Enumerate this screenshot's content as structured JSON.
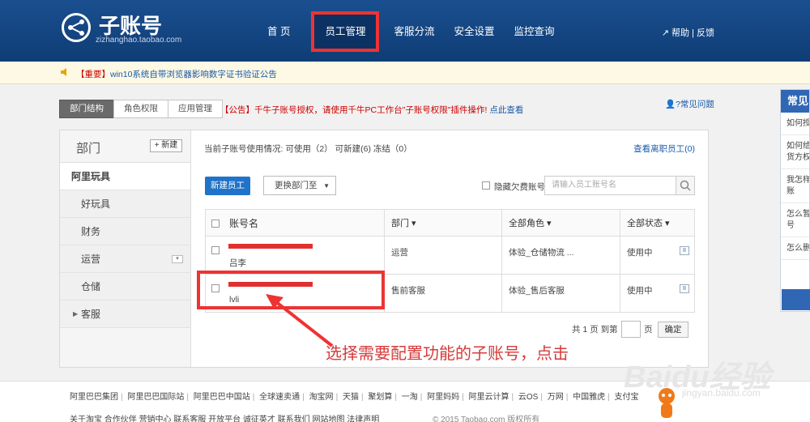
{
  "header": {
    "logo_title": "子账号",
    "logo_subtitle": "zizhanghao.taobao.com",
    "nav": [
      "首 页",
      "员工管理",
      "客服分流",
      "安全设置",
      "监控查询"
    ],
    "links": "帮助 | 反馈"
  },
  "notice": {
    "tag": "【重要】",
    "text": "win10系统自带浏览器影响数字证书验证公告"
  },
  "tabs": [
    "部门结构",
    "角色权限",
    "应用管理"
  ],
  "announce": {
    "text": "【公告】千牛子账号授权，请使用千牛PC工作台\"子账号权限\"插件操作! ",
    "link": "点此查看"
  },
  "faq_link": "常见问题",
  "sidebar": {
    "title": "部门",
    "new_label": "+ 新建",
    "root": "阿里玩具",
    "items": [
      "好玩具",
      "财务",
      "运营",
      "仓储",
      "客服"
    ]
  },
  "content": {
    "usage_label": "当前子账号使用情况:",
    "usage_available": "可使用（2）",
    "usage_new": "可新建(6)",
    "usage_frozen": "冻结（0）",
    "resigned_link": "查看离职员工(0)",
    "btn_new": "新建员工",
    "btn_move": "更换部门至",
    "hide_label": "隐藏欠费账号",
    "search_placeholder": "请输入员工账号名"
  },
  "table": {
    "headers": [
      "账号名",
      "部门 ▾",
      "全部角色 ▾",
      "全部状态 ▾"
    ],
    "rows": [
      {
        "account_sub": "吕李",
        "dept": "运营",
        "role": "体验_仓储物流 ...",
        "status": "使用中"
      },
      {
        "account_sub": "lvli",
        "dept": "售前客服",
        "role": "体验_售后客服",
        "status": "使用中"
      }
    ]
  },
  "pager": {
    "text": "共 1 页 到第",
    "page": "页",
    "ok": "确定"
  },
  "callout": "选择需要配置功能的子账号，点击",
  "faq_panel": {
    "title": "常见",
    "questions": [
      "如何授号?",
      "如何给如发货方权限",
      "我怎样的子账",
      "怎么暂子账号",
      "怎么删"
    ]
  },
  "footer": {
    "links1": [
      "阿里巴巴集团",
      "阿里巴巴国际站",
      "阿里巴巴中国站",
      "全球速卖通",
      "淘宝网",
      "天猫",
      "聚划算",
      "一淘",
      "阿里妈妈",
      "阿里云计算",
      "云OS",
      "万网",
      "中国雅虎",
      "支付宝"
    ],
    "links2": [
      "关于淘宝",
      "合作伙伴",
      "营销中心",
      "联系客服",
      "开放平台",
      "诚征英才",
      "联系我们",
      "网站地图",
      "法律声明"
    ],
    "copyright": "© 2015 Taobao.com 版权所有"
  },
  "watermark": {
    "text": "Baidu经验",
    "sub": "jingyan.baidu.com"
  },
  "colors": {
    "header": "#0f3d75",
    "accent": "#1f73c9",
    "highlight": "#e33333"
  }
}
